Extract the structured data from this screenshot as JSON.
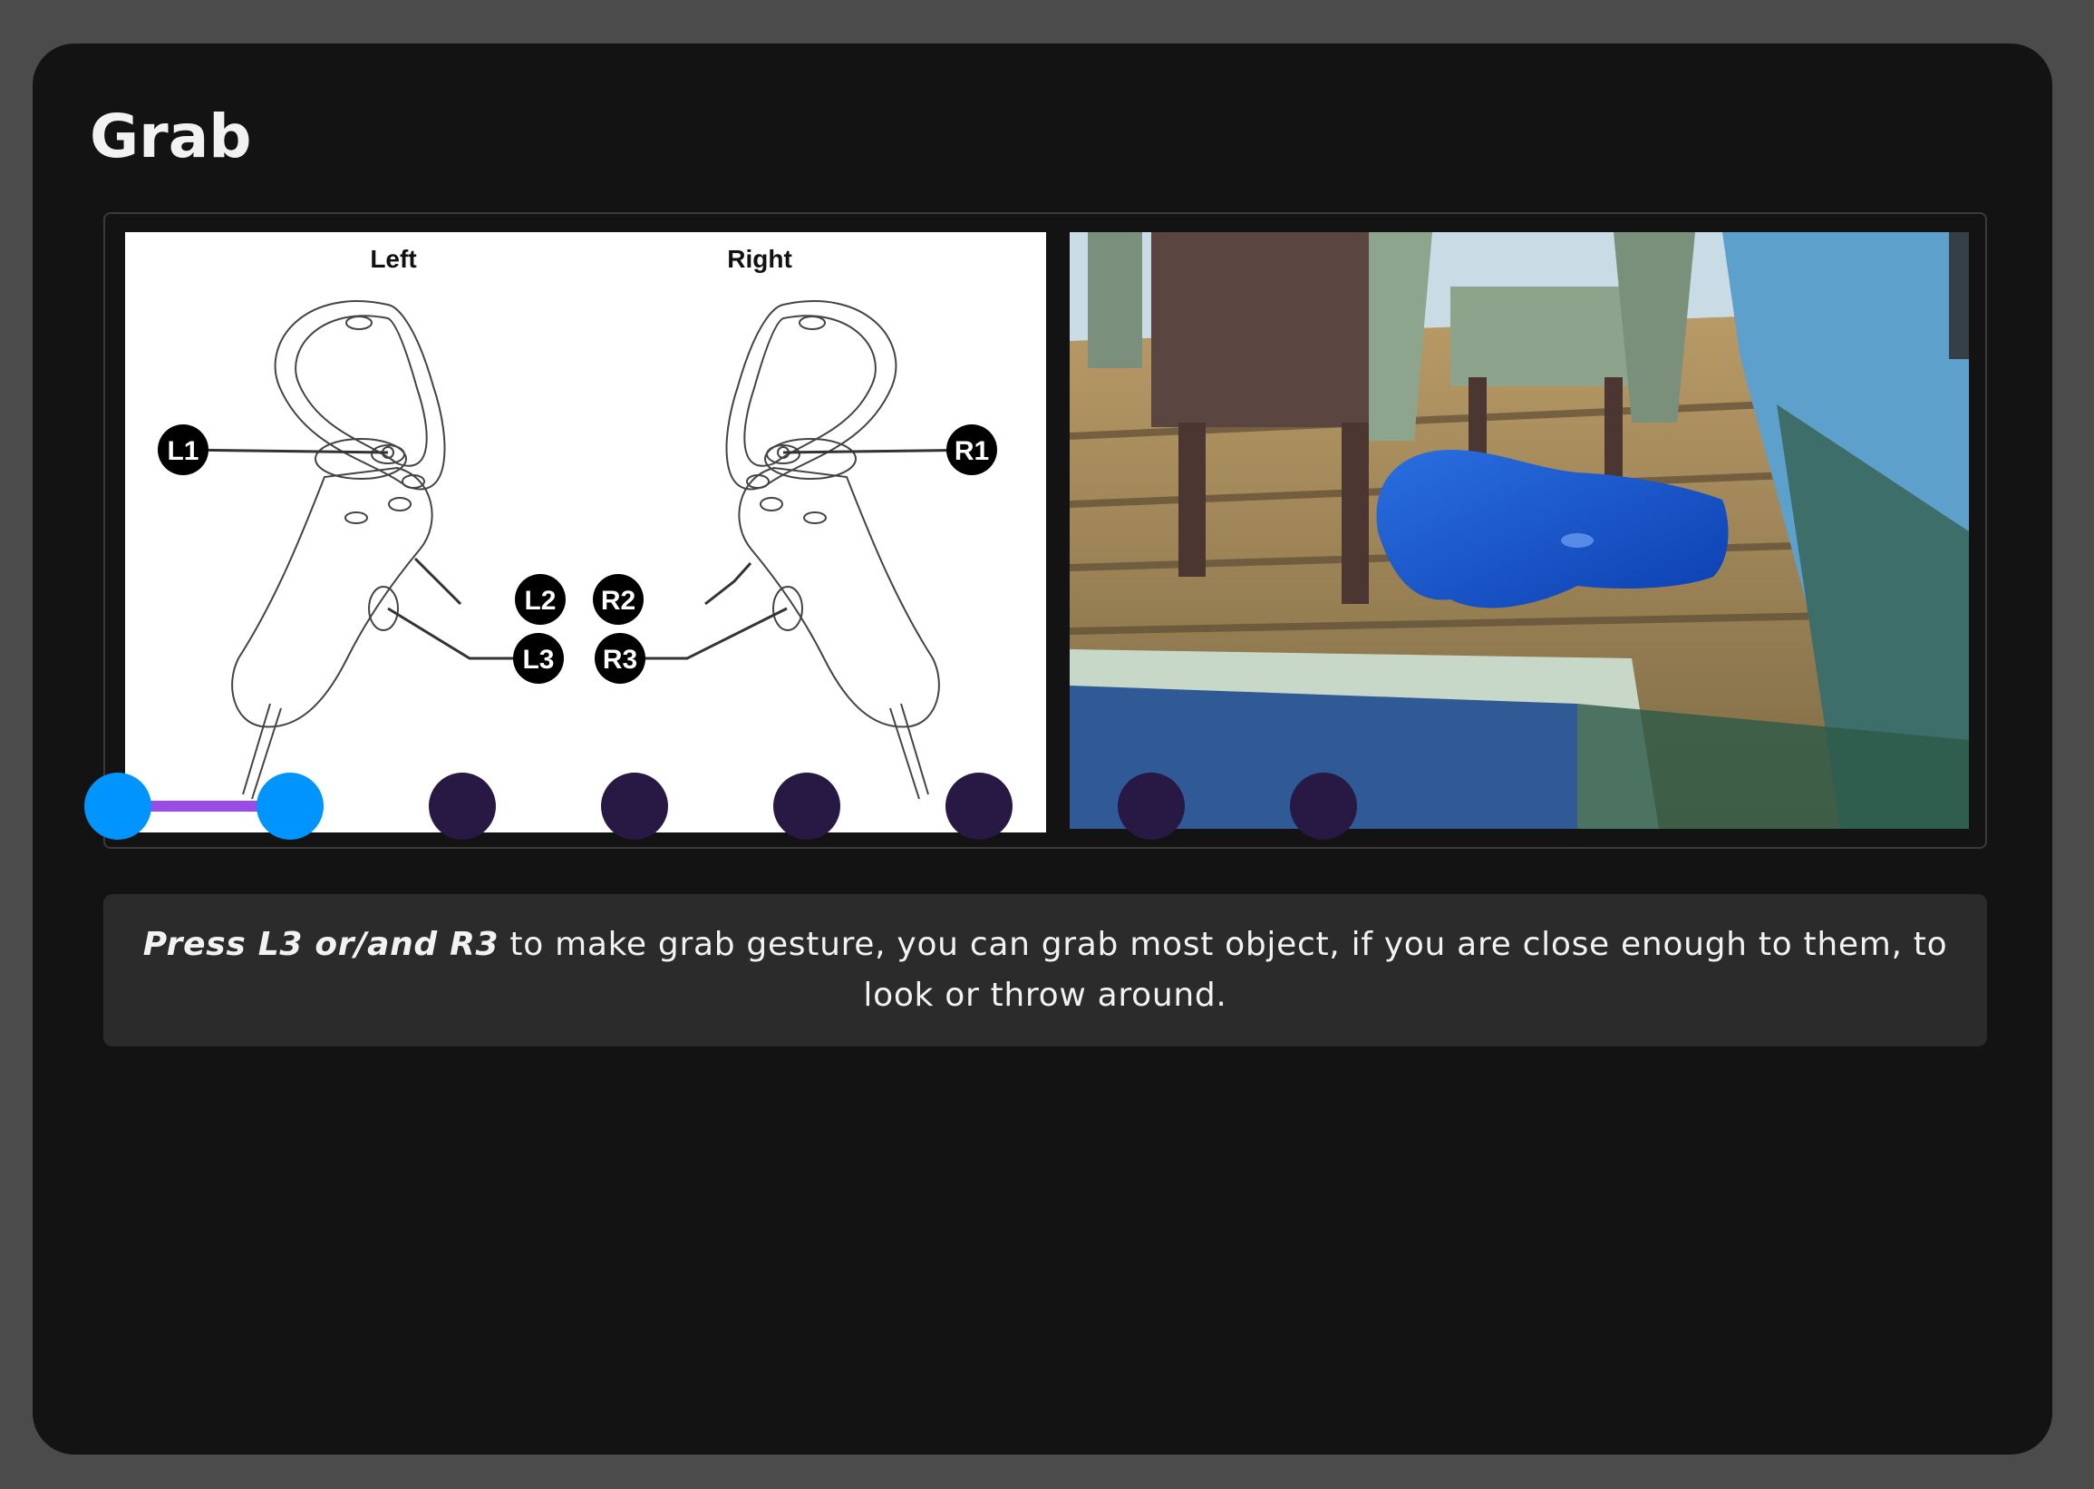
{
  "page": {
    "title": "Grab"
  },
  "diagram": {
    "left_label": "Left",
    "right_label": "Right",
    "buttons": {
      "l1": "L1",
      "l2": "L2",
      "l3": "L3",
      "r1": "R1",
      "r2": "R2",
      "r3": "R3"
    }
  },
  "caption": {
    "emphasis": "Press L3 or/and R3",
    "text": " to make grab gesture, you can grab most object, if you are close enough to them, to look or throw around."
  },
  "stepper": {
    "total_steps": 8,
    "current_step": 2,
    "active_color": "#0094ff",
    "inactive_color": "#271844",
    "progress_color": "#9a4de6"
  }
}
